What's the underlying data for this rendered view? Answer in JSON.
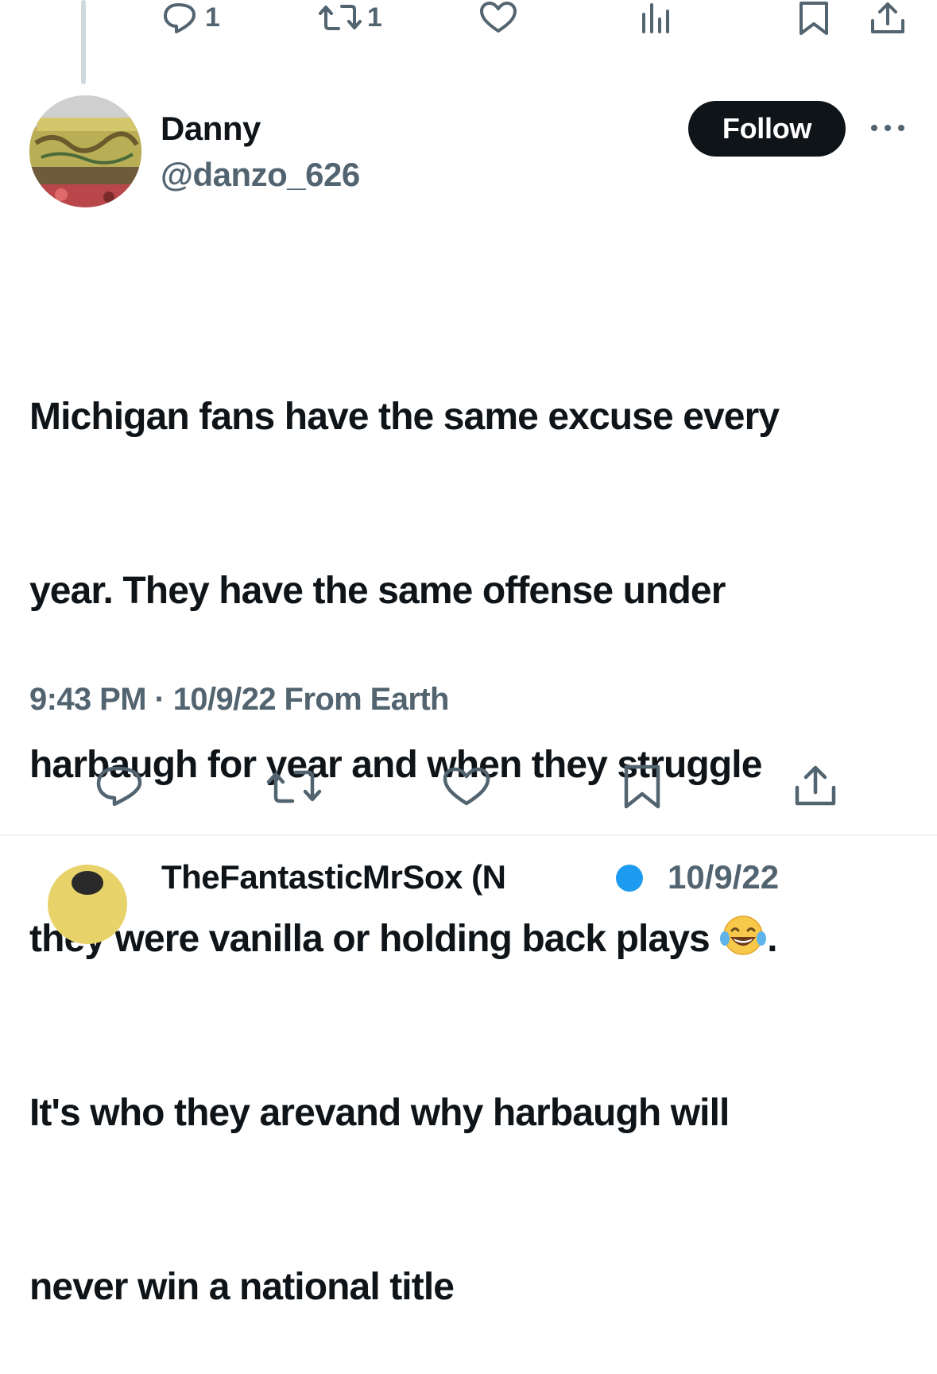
{
  "previous_tweet": {
    "reply_count": "1",
    "retweet_count": "1",
    "icons": [
      "reply-icon",
      "retweet-icon",
      "like-icon",
      "analytics-icon",
      "bookmark-icon",
      "share-icon"
    ]
  },
  "tweet": {
    "author_name": "Danny",
    "author_handle": "@danzo_626",
    "follow_label": "Follow",
    "text_line1": "Michigan fans have the same excuse every",
    "text_line2": "year. They have the same offense under",
    "text_line3": "harbaugh for year and when they struggle",
    "text_line4_before_emoji": "they were vanilla or holding back plays ",
    "emoji": "face-with-tears-of-joy",
    "text_line4_after_emoji": ".",
    "text_line5": "It's who they arevand why harbaugh will",
    "text_line6": "never win a national title",
    "time": "9:43 PM",
    "separator": " · ",
    "date": "10/9/22",
    "source": "From Earth",
    "action_icons": [
      "reply-icon",
      "retweet-icon",
      "like-icon",
      "bookmark-icon",
      "share-icon"
    ]
  },
  "next_tweet": {
    "author_name_partial": "TheFantasticMrSox (N",
    "date_partial": "10/9/22"
  },
  "colors": {
    "text": "#0f1419",
    "secondary": "#536471",
    "follow_bg": "#0f1419",
    "verified": "#1d9bf0"
  }
}
